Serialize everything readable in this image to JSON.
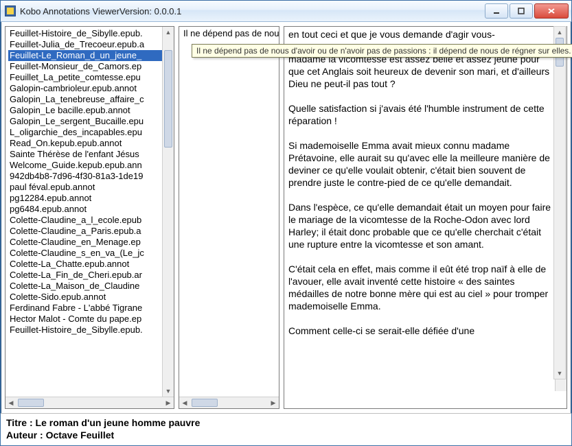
{
  "window": {
    "title": "Kobo Annotations ViewerVersion: 0.0.0.1"
  },
  "left_list": {
    "selected_index": 2,
    "items": [
      "Feuillet-Histoire_de_Sibylle.epub.",
      "Feuillet-Julia_de_Trecoeur.epub.a",
      "Feuillet-Le_Roman_d_un_jeune_",
      "Feuillet-Monsieur_de_Camors.ep",
      "Feuillet_La_petite_comtesse.epu",
      "Galopin-cambrioleur.epub.annot",
      "Galopin_La_tenebreuse_affaire_c",
      "Galopin_Le bacille.epub.annot",
      "Galopin_Le_sergent_Bucaille.epu",
      "L_oligarchie_des_incapables.epu",
      "Read_On.kepub.epub.annot",
      "Sainte Thérèse de l'enfant Jésus",
      "Welcome_Guide.kepub.epub.ann",
      "942db4b8-7d96-4f30-81a3-1de19",
      "paul féval.epub.annot",
      "pg12284.epub.annot",
      "pg6484.epub.annot",
      "Colette-Claudine_a_l_ecole.epub",
      "Colette-Claudine_a_Paris.epub.a",
      "Colette-Claudine_en_Menage.ep",
      "Colette-Claudine_s_en_va_(Le_jc",
      "Colette-La_Chatte.epub.annot",
      "Colette-La_Fin_de_Cheri.epub.ar",
      "Colette-La_Maison_de_Claudine",
      "Colette-Sido.epub.annot",
      "Ferdinand Fabre - L'abbé Tigrane",
      "Hector Malot - Comte du pape.ep",
      "Feuillet-Histoire_de_Sibylle.epub."
    ]
  },
  "middle_list": {
    "items": [
      "Il ne dépend pas de nou"
    ]
  },
  "tooltip_text": "Il ne dépend pas de nous d'avoir ou de n'avoir pas de passions : il dépend de nous de régner sur elles.",
  "right_text": "en tout ceci et que je vous demande d'agir vous-\n\nmadame la vicomtesse est assez belle et assez jeune pour que cet Anglais soit heureux de devenir son mari, et d'ailleurs Dieu ne peut-il pas tout ?\n\nQuelle satisfaction si j'avais été l'humble instrument de cette réparation !\n\nSi mademoiselle Emma avait mieux connu madame Prétavoine, elle aurait su qu'avec elle la meilleure manière de deviner ce qu'elle voulait obtenir, c'était bien souvent de prendre juste le contre-pied de ce qu'elle demandait.\n\nDans l'espèce, ce qu'elle demandait était un moyen pour faire le mariage de la vicomtesse de la Roche-Odon avec lord Harley; il était donc probable que ce qu'elle cherchait c'était une rupture entre la vicomtesse et son amant.\n\nC'était cela en effet, mais comme il eût été trop naïf à elle de l'avouer, elle avait inventé cette histoire « des saintes médailles de notre bonne mère qui est au ciel » pour tromper mademoiselle Emma.\n\nComment celle-ci se serait-elle défiée d'une",
  "footer": {
    "title_label": "Titre : ",
    "title_value": "Le roman d'un jeune homme pauvre",
    "author_label": "Auteur : ",
    "author_value": "Octave Feuillet"
  }
}
